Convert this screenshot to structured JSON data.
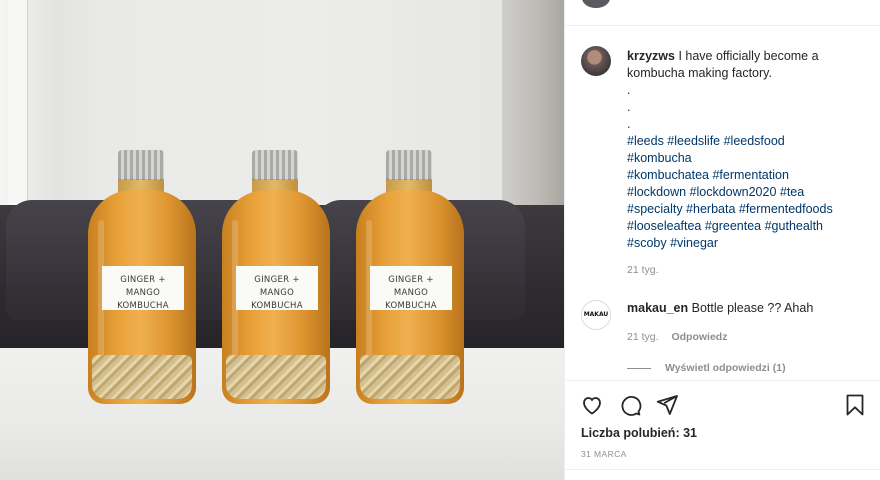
{
  "post": {
    "author": "krzyzws",
    "caption": "I have officially become a kombucha making factory.",
    "dots": [
      ".",
      ".",
      "."
    ],
    "hashtag_lines": [
      "#leeds #leedslife #leedsfood",
      "#kombucha",
      "#kombuchatea #fermentation",
      "#lockdown #lockdown2020 #tea",
      "#specialty #herbata #fermentedfoods",
      "#looseleaftea #greentea #guthealth",
      "#scoby #vinegar"
    ],
    "caption_time": "21 tyg."
  },
  "photo": {
    "bottle_label_line1": "GINGER + MANGO",
    "bottle_label_line2": "KOMBUCHA"
  },
  "comments": [
    {
      "author": "makau_en",
      "avatar_text": "MAKAU",
      "text": "Bottle please ?? Ahah",
      "time": "21 tyg.",
      "reply_label": "Odpowiedz",
      "view_replies": "Wyświetl odpowiedzi (1)"
    }
  ],
  "actions": {
    "icons": [
      "heart-icon",
      "comment-icon",
      "share-icon",
      "bookmark-icon"
    ],
    "likes_text": "Liczba polubień: 31",
    "date": "31 MARCA"
  },
  "colors": {
    "hashtag": "#00376b",
    "text": "#262626",
    "muted": "#8e8e8e"
  }
}
